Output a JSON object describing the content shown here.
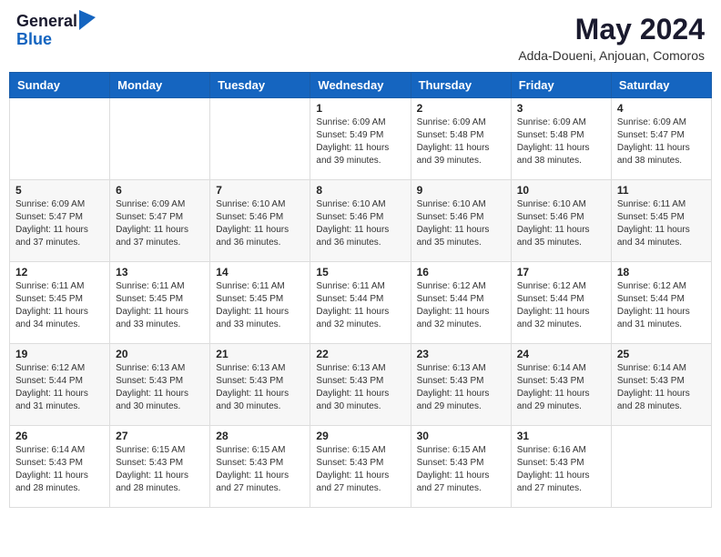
{
  "logo": {
    "general": "General",
    "blue": "Blue"
  },
  "title": {
    "month_year": "May 2024",
    "location": "Adda-Doueni, Anjouan, Comoros"
  },
  "weekdays": [
    "Sunday",
    "Monday",
    "Tuesday",
    "Wednesday",
    "Thursday",
    "Friday",
    "Saturday"
  ],
  "weeks": [
    [
      {
        "day": "",
        "info": ""
      },
      {
        "day": "",
        "info": ""
      },
      {
        "day": "",
        "info": ""
      },
      {
        "day": "1",
        "info": "Sunrise: 6:09 AM\nSunset: 5:49 PM\nDaylight: 11 hours and 39 minutes."
      },
      {
        "day": "2",
        "info": "Sunrise: 6:09 AM\nSunset: 5:48 PM\nDaylight: 11 hours and 39 minutes."
      },
      {
        "day": "3",
        "info": "Sunrise: 6:09 AM\nSunset: 5:48 PM\nDaylight: 11 hours and 38 minutes."
      },
      {
        "day": "4",
        "info": "Sunrise: 6:09 AM\nSunset: 5:47 PM\nDaylight: 11 hours and 38 minutes."
      }
    ],
    [
      {
        "day": "5",
        "info": "Sunrise: 6:09 AM\nSunset: 5:47 PM\nDaylight: 11 hours and 37 minutes."
      },
      {
        "day": "6",
        "info": "Sunrise: 6:09 AM\nSunset: 5:47 PM\nDaylight: 11 hours and 37 minutes."
      },
      {
        "day": "7",
        "info": "Sunrise: 6:10 AM\nSunset: 5:46 PM\nDaylight: 11 hours and 36 minutes."
      },
      {
        "day": "8",
        "info": "Sunrise: 6:10 AM\nSunset: 5:46 PM\nDaylight: 11 hours and 36 minutes."
      },
      {
        "day": "9",
        "info": "Sunrise: 6:10 AM\nSunset: 5:46 PM\nDaylight: 11 hours and 35 minutes."
      },
      {
        "day": "10",
        "info": "Sunrise: 6:10 AM\nSunset: 5:46 PM\nDaylight: 11 hours and 35 minutes."
      },
      {
        "day": "11",
        "info": "Sunrise: 6:11 AM\nSunset: 5:45 PM\nDaylight: 11 hours and 34 minutes."
      }
    ],
    [
      {
        "day": "12",
        "info": "Sunrise: 6:11 AM\nSunset: 5:45 PM\nDaylight: 11 hours and 34 minutes."
      },
      {
        "day": "13",
        "info": "Sunrise: 6:11 AM\nSunset: 5:45 PM\nDaylight: 11 hours and 33 minutes."
      },
      {
        "day": "14",
        "info": "Sunrise: 6:11 AM\nSunset: 5:45 PM\nDaylight: 11 hours and 33 minutes."
      },
      {
        "day": "15",
        "info": "Sunrise: 6:11 AM\nSunset: 5:44 PM\nDaylight: 11 hours and 32 minutes."
      },
      {
        "day": "16",
        "info": "Sunrise: 6:12 AM\nSunset: 5:44 PM\nDaylight: 11 hours and 32 minutes."
      },
      {
        "day": "17",
        "info": "Sunrise: 6:12 AM\nSunset: 5:44 PM\nDaylight: 11 hours and 32 minutes."
      },
      {
        "day": "18",
        "info": "Sunrise: 6:12 AM\nSunset: 5:44 PM\nDaylight: 11 hours and 31 minutes."
      }
    ],
    [
      {
        "day": "19",
        "info": "Sunrise: 6:12 AM\nSunset: 5:44 PM\nDaylight: 11 hours and 31 minutes."
      },
      {
        "day": "20",
        "info": "Sunrise: 6:13 AM\nSunset: 5:43 PM\nDaylight: 11 hours and 30 minutes."
      },
      {
        "day": "21",
        "info": "Sunrise: 6:13 AM\nSunset: 5:43 PM\nDaylight: 11 hours and 30 minutes."
      },
      {
        "day": "22",
        "info": "Sunrise: 6:13 AM\nSunset: 5:43 PM\nDaylight: 11 hours and 30 minutes."
      },
      {
        "day": "23",
        "info": "Sunrise: 6:13 AM\nSunset: 5:43 PM\nDaylight: 11 hours and 29 minutes."
      },
      {
        "day": "24",
        "info": "Sunrise: 6:14 AM\nSunset: 5:43 PM\nDaylight: 11 hours and 29 minutes."
      },
      {
        "day": "25",
        "info": "Sunrise: 6:14 AM\nSunset: 5:43 PM\nDaylight: 11 hours and 28 minutes."
      }
    ],
    [
      {
        "day": "26",
        "info": "Sunrise: 6:14 AM\nSunset: 5:43 PM\nDaylight: 11 hours and 28 minutes."
      },
      {
        "day": "27",
        "info": "Sunrise: 6:15 AM\nSunset: 5:43 PM\nDaylight: 11 hours and 28 minutes."
      },
      {
        "day": "28",
        "info": "Sunrise: 6:15 AM\nSunset: 5:43 PM\nDaylight: 11 hours and 27 minutes."
      },
      {
        "day": "29",
        "info": "Sunrise: 6:15 AM\nSunset: 5:43 PM\nDaylight: 11 hours and 27 minutes."
      },
      {
        "day": "30",
        "info": "Sunrise: 6:15 AM\nSunset: 5:43 PM\nDaylight: 11 hours and 27 minutes."
      },
      {
        "day": "31",
        "info": "Sunrise: 6:16 AM\nSunset: 5:43 PM\nDaylight: 11 hours and 27 minutes."
      },
      {
        "day": "",
        "info": ""
      }
    ]
  ]
}
